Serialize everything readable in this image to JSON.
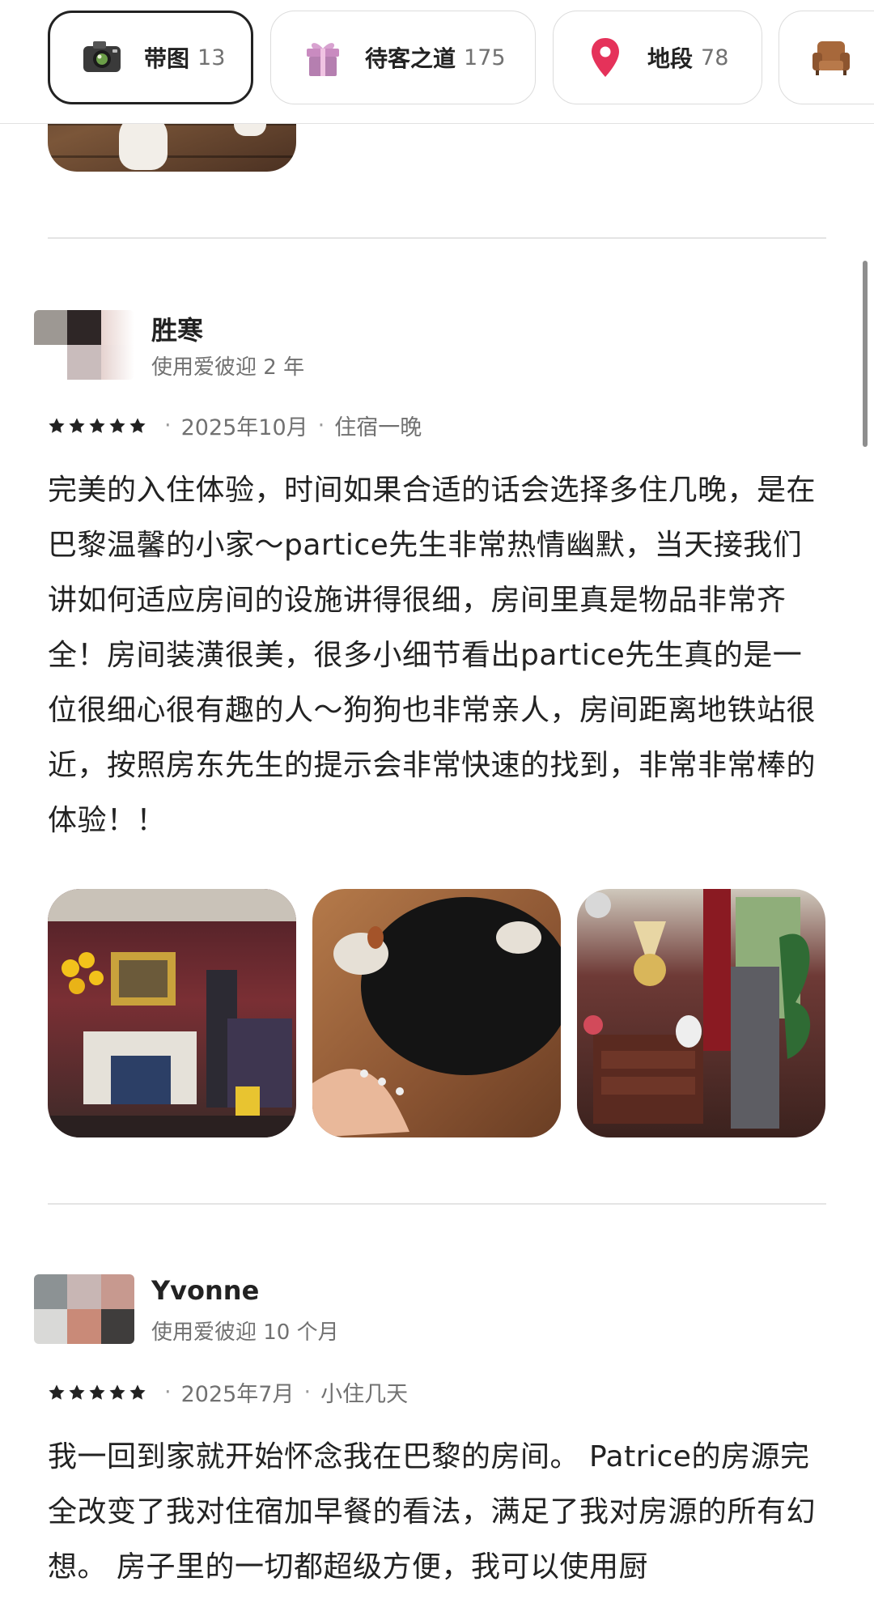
{
  "filters": [
    {
      "label": "带图",
      "count": "13",
      "icon": "camera-icon",
      "active": true
    },
    {
      "label": "待客之道",
      "count": "175",
      "icon": "gift-icon",
      "active": false
    },
    {
      "label": "地段",
      "count": "78",
      "icon": "location-pin-icon",
      "active": false
    },
    {
      "label": "",
      "count": "",
      "icon": "armchair-icon",
      "active": false
    }
  ],
  "reviews": [
    {
      "name": "胜寒",
      "tenure": "使用爱彼迎 2 年",
      "rating": 5,
      "date": "2025年10月",
      "stay_type": "住宿一晚",
      "text": "完美的入住体验，时间如果合适的话会选择多住几晚，是在巴黎温馨的小家～partice先生非常热情幽默，当天接我们讲如何适应房间的设施讲得很细，房间里真是物品非常齐全！房间装潢很美，很多小细节看出partice先生真的是一位很细心很有趣的人～狗狗也非常亲人，房间距离地铁站很近，按照房东先生的提示会非常快速的找到，非常非常棒的体验！！",
      "photos": [
        "living-room-photo",
        "dog-photo",
        "antique-room-photo"
      ]
    },
    {
      "name": "Yvonne",
      "tenure": "使用爱彼迎 10 个月",
      "rating": 5,
      "date": "2025年7月",
      "stay_type": "小住几天",
      "text": "我一回到家就开始怀念我在巴黎的房间。 Patrice的房源完全改变了我对住宿加早餐的看法，满足了我对房源的所有幻想。 房子里的一切都超级方便，我可以使用厨"
    }
  ],
  "colors": {
    "text_primary": "#222222",
    "text_secondary": "#717171",
    "divider": "#e4e4e4",
    "pin": "#e5325a"
  }
}
